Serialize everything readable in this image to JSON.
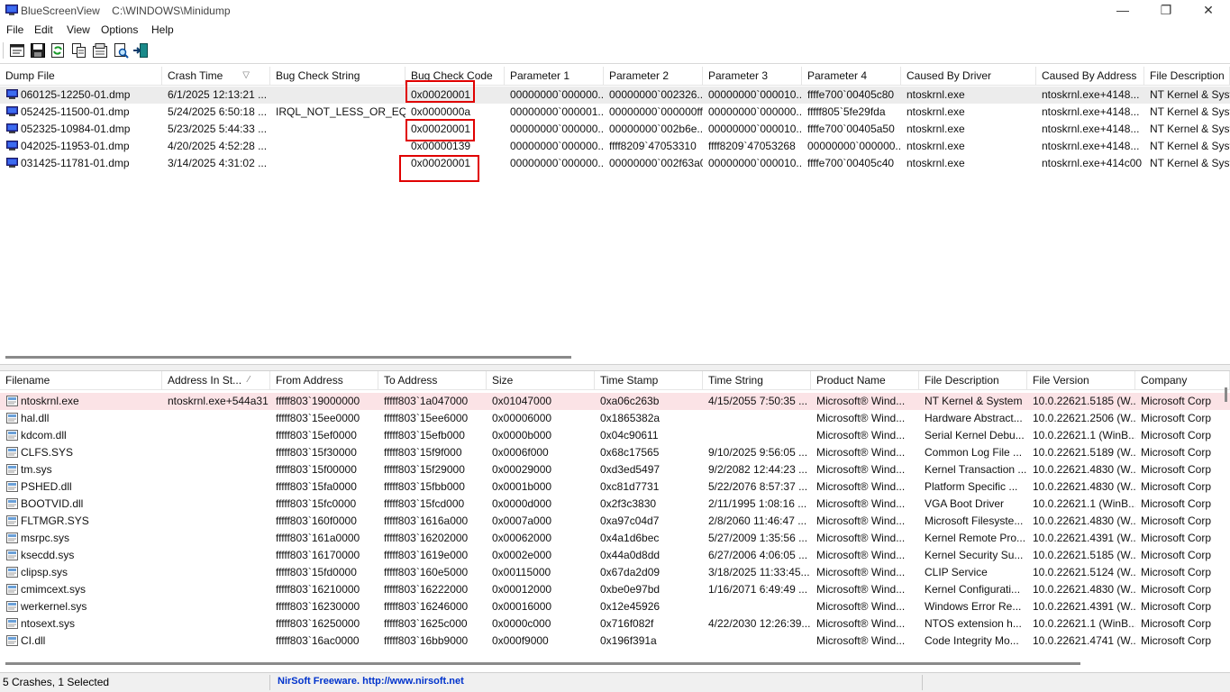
{
  "window": {
    "title": "BlueScreenView    C:\\WINDOWS\\Minidump",
    "minimize": "—",
    "maximize": "❐",
    "close": "✕"
  },
  "menu": {
    "file": "File",
    "edit": "Edit",
    "view": "View",
    "options": "Options",
    "help": "Help"
  },
  "toolbar_icons": [
    "html-report-icon",
    "save-icon",
    "refresh-icon",
    "copy-icon",
    "properties-icon",
    "find-icon",
    "exit-icon"
  ],
  "dumps": {
    "headers": [
      "Dump File",
      "Crash Time",
      "Bug Check String",
      "Bug Check Code",
      "Parameter 1",
      "Parameter 2",
      "Parameter 3",
      "Parameter 4",
      "Caused By Driver",
      "Caused By Address",
      "File Description"
    ],
    "sort_glyph": "▽",
    "rows": [
      [
        "060125-12250-01.dmp",
        "6/1/2025 12:13:21 ...",
        "",
        "0x00020001",
        "00000000`000000...",
        "00000000`002326...",
        "00000000`000010...",
        "ffffe700`00405c80",
        "ntoskrnl.exe",
        "ntoskrnl.exe+4148...",
        "NT Kernel & System"
      ],
      [
        "052425-11500-01.dmp",
        "5/24/2025 6:50:18 ...",
        "IRQL_NOT_LESS_OR_EQ...",
        "0x0000000a",
        "00000000`000001...",
        "00000000`000000ff",
        "00000000`000000...",
        "fffff805`5fe29fda",
        "ntoskrnl.exe",
        "ntoskrnl.exe+4148...",
        "NT Kernel & System"
      ],
      [
        "052325-10984-01.dmp",
        "5/23/2025 5:44:33 ...",
        "",
        "0x00020001",
        "00000000`000000...",
        "00000000`002b6e...",
        "00000000`000010...",
        "ffffe700`00405a50",
        "ntoskrnl.exe",
        "ntoskrnl.exe+4148...",
        "NT Kernel & System"
      ],
      [
        "042025-11953-01.dmp",
        "4/20/2025 4:52:28 ...",
        "",
        "0x00000139",
        "00000000`000000...",
        "ffff8209`47053310",
        "ffff8209`47053268",
        "00000000`000000...",
        "ntoskrnl.exe",
        "ntoskrnl.exe+4148...",
        "NT Kernel & System"
      ],
      [
        "031425-11781-01.dmp",
        "3/14/2025 4:31:02 ...",
        "",
        "0x00020001",
        "00000000`000000...",
        "00000000`002f63a0",
        "00000000`000010...",
        "ffffe700`00405c40",
        "ntoskrnl.exe",
        "ntoskrnl.exe+414c00",
        "NT Kernel & System"
      ]
    ]
  },
  "drivers": {
    "headers": [
      "Filename",
      "Address In St...",
      "From Address",
      "To Address",
      "Size",
      "Time Stamp",
      "Time String",
      "Product Name",
      "File Description",
      "File Version",
      "Company"
    ],
    "sort_glyph": "⁄",
    "rows": [
      [
        "ntoskrnl.exe",
        "ntoskrnl.exe+544a31",
        "fffff803`19000000",
        "fffff803`1a047000",
        "0x01047000",
        "0xa06c263b",
        "4/15/2055 7:50:35 ...",
        "Microsoft® Wind...",
        "NT Kernel & System",
        "10.0.22621.5185 (W...",
        "Microsoft Corp"
      ],
      [
        "hal.dll",
        "",
        "fffff803`15ee0000",
        "fffff803`15ee6000",
        "0x00006000",
        "0x1865382a",
        "",
        "Microsoft® Wind...",
        "Hardware Abstract...",
        "10.0.22621.2506 (W...",
        "Microsoft Corp"
      ],
      [
        "kdcom.dll",
        "",
        "fffff803`15ef0000",
        "fffff803`15efb000",
        "0x0000b000",
        "0x04c90611",
        "",
        "Microsoft® Wind...",
        "Serial Kernel Debu...",
        "10.0.22621.1 (WinB...",
        "Microsoft Corp"
      ],
      [
        "CLFS.SYS",
        "",
        "fffff803`15f30000",
        "fffff803`15f9f000",
        "0x0006f000",
        "0x68c17565",
        "9/10/2025 9:56:05 ...",
        "Microsoft® Wind...",
        "Common Log File ...",
        "10.0.22621.5189 (W...",
        "Microsoft Corp"
      ],
      [
        "tm.sys",
        "",
        "fffff803`15f00000",
        "fffff803`15f29000",
        "0x00029000",
        "0xd3ed5497",
        "9/2/2082 12:44:23 ...",
        "Microsoft® Wind...",
        "Kernel Transaction ...",
        "10.0.22621.4830 (W...",
        "Microsoft Corp"
      ],
      [
        "PSHED.dll",
        "",
        "fffff803`15fa0000",
        "fffff803`15fbb000",
        "0x0001b000",
        "0xc81d7731",
        "5/22/2076 8:57:37 ...",
        "Microsoft® Wind...",
        "Platform Specific ...",
        "10.0.22621.4830 (W...",
        "Microsoft Corp"
      ],
      [
        "BOOTVID.dll",
        "",
        "fffff803`15fc0000",
        "fffff803`15fcd000",
        "0x0000d000",
        "0x2f3c3830",
        "2/11/1995 1:08:16 ...",
        "Microsoft® Wind...",
        "VGA Boot Driver",
        "10.0.22621.1 (WinB...",
        "Microsoft Corp"
      ],
      [
        "FLTMGR.SYS",
        "",
        "fffff803`160f0000",
        "fffff803`1616a000",
        "0x0007a000",
        "0xa97c04d7",
        "2/8/2060 11:46:47 ...",
        "Microsoft® Wind...",
        "Microsoft Filesyste...",
        "10.0.22621.4830 (W...",
        "Microsoft Corp"
      ],
      [
        "msrpc.sys",
        "",
        "fffff803`161a0000",
        "fffff803`16202000",
        "0x00062000",
        "0x4a1d6bec",
        "5/27/2009 1:35:56 ...",
        "Microsoft® Wind...",
        "Kernel Remote Pro...",
        "10.0.22621.4391 (W...",
        "Microsoft Corp"
      ],
      [
        "ksecdd.sys",
        "",
        "fffff803`16170000",
        "fffff803`1619e000",
        "0x0002e000",
        "0x44a0d8dd",
        "6/27/2006 4:06:05 ...",
        "Microsoft® Wind...",
        "Kernel Security Su...",
        "10.0.22621.5185 (W...",
        "Microsoft Corp"
      ],
      [
        "clipsp.sys",
        "",
        "fffff803`15fd0000",
        "fffff803`160e5000",
        "0x00115000",
        "0x67da2d09",
        "3/18/2025 11:33:45...",
        "Microsoft® Wind...",
        "CLIP Service",
        "10.0.22621.5124 (W...",
        "Microsoft Corp"
      ],
      [
        "cmimcext.sys",
        "",
        "fffff803`16210000",
        "fffff803`16222000",
        "0x00012000",
        "0xbe0e97bd",
        "1/16/2071 6:49:49 ...",
        "Microsoft® Wind...",
        "Kernel Configurati...",
        "10.0.22621.4830 (W...",
        "Microsoft Corp"
      ],
      [
        "werkernel.sys",
        "",
        "fffff803`16230000",
        "fffff803`16246000",
        "0x00016000",
        "0x12e45926",
        "",
        "Microsoft® Wind...",
        "Windows Error Re...",
        "10.0.22621.4391 (W...",
        "Microsoft Corp"
      ],
      [
        "ntosext.sys",
        "",
        "fffff803`16250000",
        "fffff803`1625c000",
        "0x0000c000",
        "0x716f082f",
        "4/22/2030 12:26:39...",
        "Microsoft® Wind...",
        "NTOS extension h...",
        "10.0.22621.1 (WinB...",
        "Microsoft Corp"
      ],
      [
        "CI.dll",
        "",
        "fffff803`16ac0000",
        "fffff803`16bb9000",
        "0x000f9000",
        "0x196f391a",
        "",
        "Microsoft® Wind...",
        "Code Integrity Mo...",
        "10.0.22621.4741 (W...",
        "Microsoft Corp"
      ]
    ]
  },
  "status": {
    "count": "5 Crashes, 1 Selected",
    "credit": "NirSoft Freeware.  http://www.nirsoft.net"
  },
  "colors": {
    "selected_row": "#ececec",
    "highlight_row": "#fbe3e6",
    "annotation_box": "#e00000",
    "link": "#0033cc"
  }
}
